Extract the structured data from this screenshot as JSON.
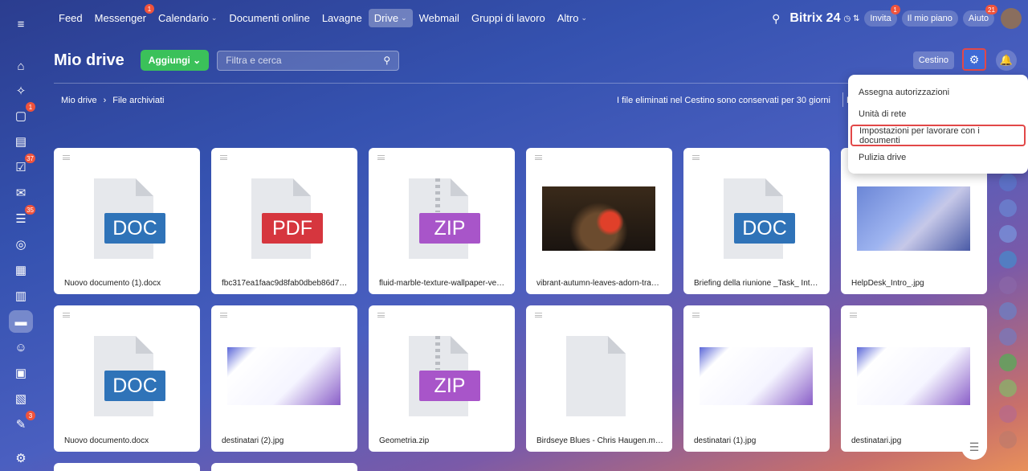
{
  "topbar": {
    "nav": [
      {
        "label": "Feed",
        "badge": ""
      },
      {
        "label": "Messenger",
        "badge": "1"
      },
      {
        "label": "Calendario",
        "badge": "",
        "dropdown": true
      },
      {
        "label": "Documenti online",
        "badge": ""
      },
      {
        "label": "Lavagne",
        "badge": ""
      },
      {
        "label": "Drive",
        "badge": "",
        "dropdown": true,
        "active": true
      },
      {
        "label": "Webmail",
        "badge": ""
      },
      {
        "label": "Gruppi di lavoro",
        "badge": ""
      },
      {
        "label": "Altro",
        "badge": "",
        "dropdown": true
      }
    ],
    "brand": "Bitrix 24",
    "invite_label": "Invita",
    "invite_badge": "1",
    "plan_label": "Il mio piano",
    "help_label": "Aiuto",
    "help_badge": "21"
  },
  "left_rail": {
    "items": [
      {
        "icon": "menu-icon",
        "badge": ""
      },
      {
        "icon": "home-icon",
        "badge": ""
      },
      {
        "icon": "ai-icon",
        "badge": ""
      },
      {
        "icon": "chat-icon",
        "badge": "1"
      },
      {
        "icon": "feed-icon",
        "badge": ""
      },
      {
        "icon": "tasks-icon",
        "badge": "37"
      },
      {
        "icon": "mail-icon",
        "badge": ""
      },
      {
        "icon": "crm-icon",
        "badge": "35"
      },
      {
        "icon": "target-icon",
        "badge": ""
      },
      {
        "icon": "calendar-icon",
        "badge": ""
      },
      {
        "icon": "docs-icon",
        "badge": ""
      },
      {
        "icon": "drive-icon",
        "badge": "",
        "active": true
      },
      {
        "icon": "groups-icon",
        "badge": ""
      },
      {
        "icon": "board-icon",
        "badge": ""
      },
      {
        "icon": "planner-icon",
        "badge": ""
      },
      {
        "icon": "sign-icon",
        "badge": "3"
      },
      {
        "icon": "settings-icon",
        "badge": ""
      }
    ]
  },
  "header": {
    "title": "Mio drive",
    "add_label": "Aggiungi",
    "search_placeholder": "Filtra e cerca",
    "trash_label": "Cestino"
  },
  "breadcrumb": [
    "Mio drive",
    "File archiviati"
  ],
  "trash_note": "I file eliminati nel Cestino sono conservati per 30 giorni",
  "note_cut": "P",
  "dropdown": {
    "items": [
      "Assegna autorizzazioni",
      "Unità di rete",
      "Impostazioni per lavorare con i documenti",
      "Pulizia drive"
    ]
  },
  "files": [
    {
      "name": "Nuovo documento (1).docx",
      "type": "DOC"
    },
    {
      "name": "fbc317ea1faac9d8fab0dbeb86d7c9c3....",
      "type": "PDF"
    },
    {
      "name": "fluid-marble-texture-wallpaper-vecto...",
      "type": "ZIP"
    },
    {
      "name": "vibrant-autumn-leaves-adorn-tranqu...",
      "type": "image"
    },
    {
      "name": "Briefing della riunione _Task_ Intervis...",
      "type": "DOC"
    },
    {
      "name": "HelpDesk_Intro_.jpg",
      "type": "image"
    },
    {
      "name": "Nuovo documento.docx",
      "type": "DOC"
    },
    {
      "name": "destinatari (2).jpg",
      "type": "screenshot"
    },
    {
      "name": "Geometria.zip",
      "type": "ZIP"
    },
    {
      "name": "Birdseye Blues - Chris Haugen.mp3",
      "type": "blank"
    },
    {
      "name": "destinatari (1).jpg",
      "type": "screenshot"
    },
    {
      "name": "destinatari.jpg",
      "type": "screenshot"
    }
  ],
  "colors": {
    "doc": "#2f73b8",
    "pdf": "#d6363e",
    "zip": "#a855c9",
    "add": "#3bc15a",
    "highlight": "#e24848"
  }
}
